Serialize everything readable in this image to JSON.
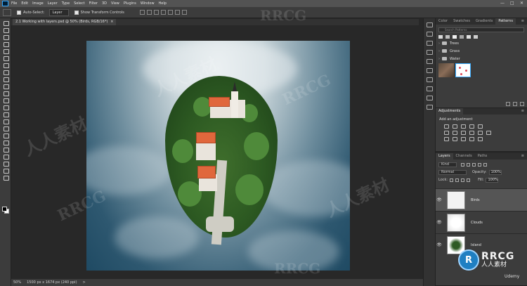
{
  "menubar": {
    "items": [
      "File",
      "Edit",
      "Image",
      "Layer",
      "Type",
      "Select",
      "Filter",
      "3D",
      "View",
      "Plugins",
      "Window",
      "Help"
    ],
    "window_controls": [
      "—",
      "□",
      "✕"
    ]
  },
  "options": {
    "auto_select_label": "Auto-Select:",
    "auto_select_value": "Layer",
    "transform_label": "Show Transform Controls"
  },
  "document": {
    "tab_title": "2.1 Working with layers.psd @ 50% (Birds, RGB/16*)",
    "close": "×"
  },
  "status": {
    "zoom": "50%",
    "doc_size": "1500 px x 1674 px (240 ppi)",
    "arrow": ">"
  },
  "panels": {
    "top_tabs": [
      "Color",
      "Swatches",
      "Gradients",
      "Patterns"
    ],
    "top_active": "Patterns",
    "search_placeholder": "Search Patterns",
    "folders": [
      "Trees",
      "Grass",
      "Water"
    ],
    "adjust_tab": "Adjustments",
    "adjust_add": "Add an adjustment",
    "layer_tabs": [
      "Layers",
      "Channels",
      "Paths"
    ],
    "layer_active": "Layers",
    "kind_label": "Kind",
    "blend_mode": "Normal",
    "opacity_label": "Opacity:",
    "opacity_value": "100%",
    "lock_label": "Lock:",
    "fill_label": "Fill:",
    "fill_value": "100%",
    "layers": [
      {
        "name": "Birds",
        "selected": true
      },
      {
        "name": "Clouds",
        "selected": false
      },
      {
        "name": "Island",
        "selected": false
      }
    ],
    "menu_icon": "≡"
  },
  "watermarks": {
    "rrcg": "RRCG",
    "chinese": "人人素材",
    "logo_letter": "R",
    "logo_big": "RRCG",
    "logo_small": "人人素材",
    "corner": "Udemy"
  },
  "icons": {
    "eye": "eye-icon",
    "folder": "folder-icon"
  },
  "colors": {
    "accent": "#31a8ff",
    "roof": "#e0673c",
    "ps_bg": "#001e36"
  }
}
